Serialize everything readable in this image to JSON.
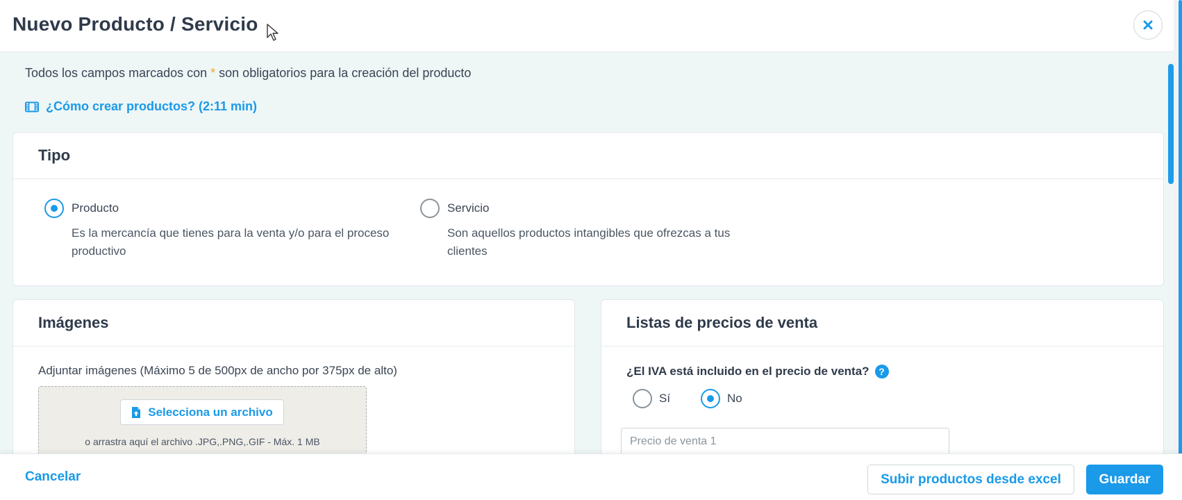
{
  "header": {
    "title": "Nuevo Producto / Servicio"
  },
  "intro": {
    "note_before": "Todos los campos marcados con ",
    "asterisk": "*",
    "note_after": " son obligatorios para la creación del producto",
    "tutorial_link": "¿Cómo crear productos? (2:11 min)"
  },
  "tipo": {
    "title": "Tipo",
    "options": [
      {
        "label": "Producto",
        "description": "Es la mercancía que tienes para la venta y/o para el proceso productivo",
        "selected": true
      },
      {
        "label": "Servicio",
        "description": "Son aquellos productos intangibles que ofrezcas a tus clientes",
        "selected": false
      }
    ]
  },
  "imagenes": {
    "title": "Imágenes",
    "instructions": "Adjuntar imágenes (Máximo 5 de 500px de ancho por 375px de alto)",
    "select_button": "Selecciona un archivo",
    "drop_hint": "o arrastra aquí el archivo .JPG,.PNG,.GIF - Máx. 1 MB"
  },
  "precios": {
    "title": "Listas de precios de venta",
    "iva_question": "¿El IVA está incluido en el precio de venta?",
    "iva_options": [
      {
        "label": "Sí",
        "selected": false
      },
      {
        "label": "No",
        "selected": true
      }
    ],
    "price_placeholder": "Precio de venta 1"
  },
  "footer": {
    "cancel": "Cancelar",
    "upload_excel": "Subir productos desde excel",
    "save": "Guardar"
  },
  "colors": {
    "accent": "#1a9ae8",
    "required_asterisk": "#f5a623",
    "page_background": "#eef6f6"
  }
}
